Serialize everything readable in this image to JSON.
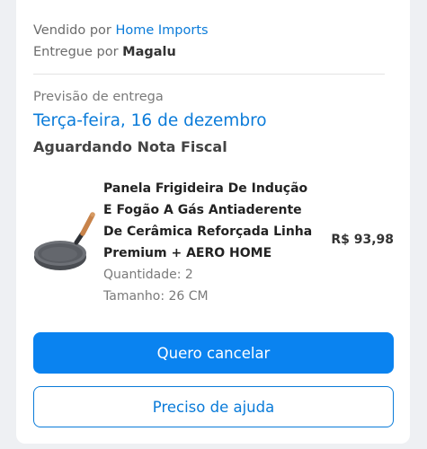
{
  "seller": {
    "sold_by_prefix": "Vendido por ",
    "sold_by_name": "Home Imports",
    "delivered_by_prefix": "Entregue por ",
    "delivered_by_name": "Magalu"
  },
  "delivery": {
    "label": "Previsão de entrega",
    "date": "Terça-feira, 16 de dezembro",
    "status": "Aguardando Nota Fiscal"
  },
  "product": {
    "name_lines": [
      "Panela Frigideira De Indução",
      "E Fogão A Gás Antiaderente",
      "De Cerâmica Reforçada Linha",
      "Premium + AERO HOME"
    ],
    "quantity": "Quantidade: 2",
    "size": "Tamanho: 26 CM",
    "price": "R$ 93,98",
    "image_icon": "frying-pan-image"
  },
  "actions": {
    "cancel_label": "Quero cancelar",
    "help_label": "Preciso de ajuda"
  },
  "colors": {
    "accent": "#0a83f0",
    "link": "#0a7bd9"
  }
}
